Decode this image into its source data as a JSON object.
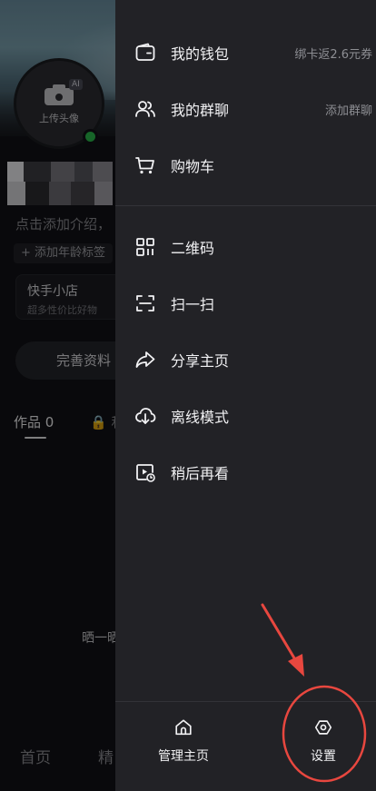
{
  "profile": {
    "ai_badge": "AI",
    "upload_avatar": "上传头像",
    "intro_placeholder": "点击添加介绍，",
    "add_age_tag": "+ 添加年龄标签",
    "shop_title": "快手小店",
    "shop_subtitle": "超多性价比好物",
    "complete_profile": "完善资料",
    "tab_works": "作品 0",
    "tab_private": "🔒 私",
    "share_hint": "晒一晒",
    "bottom_home": "首页",
    "bottom_featured": "精"
  },
  "drawer": {
    "items": [
      {
        "label": "我的钱包",
        "extra": "绑卡返2.6元券",
        "icon": "wallet-icon"
      },
      {
        "label": "我的群聊",
        "extra": "添加群聊",
        "icon": "group-chat-icon"
      },
      {
        "label": "购物车",
        "extra": "",
        "icon": "cart-icon"
      },
      {
        "label": "二维码",
        "extra": "",
        "icon": "qr-code-icon"
      },
      {
        "label": "扫一扫",
        "extra": "",
        "icon": "scan-icon"
      },
      {
        "label": "分享主页",
        "extra": "",
        "icon": "share-icon"
      },
      {
        "label": "离线模式",
        "extra": "",
        "icon": "offline-download-icon"
      },
      {
        "label": "稍后再看",
        "extra": "",
        "icon": "watch-later-icon"
      }
    ],
    "bottom": {
      "manage_home": "管理主页",
      "settings": "设置"
    }
  },
  "colors": {
    "drawer_bg": "#222226",
    "online": "#2bb84b",
    "annotation": "#e8473f"
  }
}
